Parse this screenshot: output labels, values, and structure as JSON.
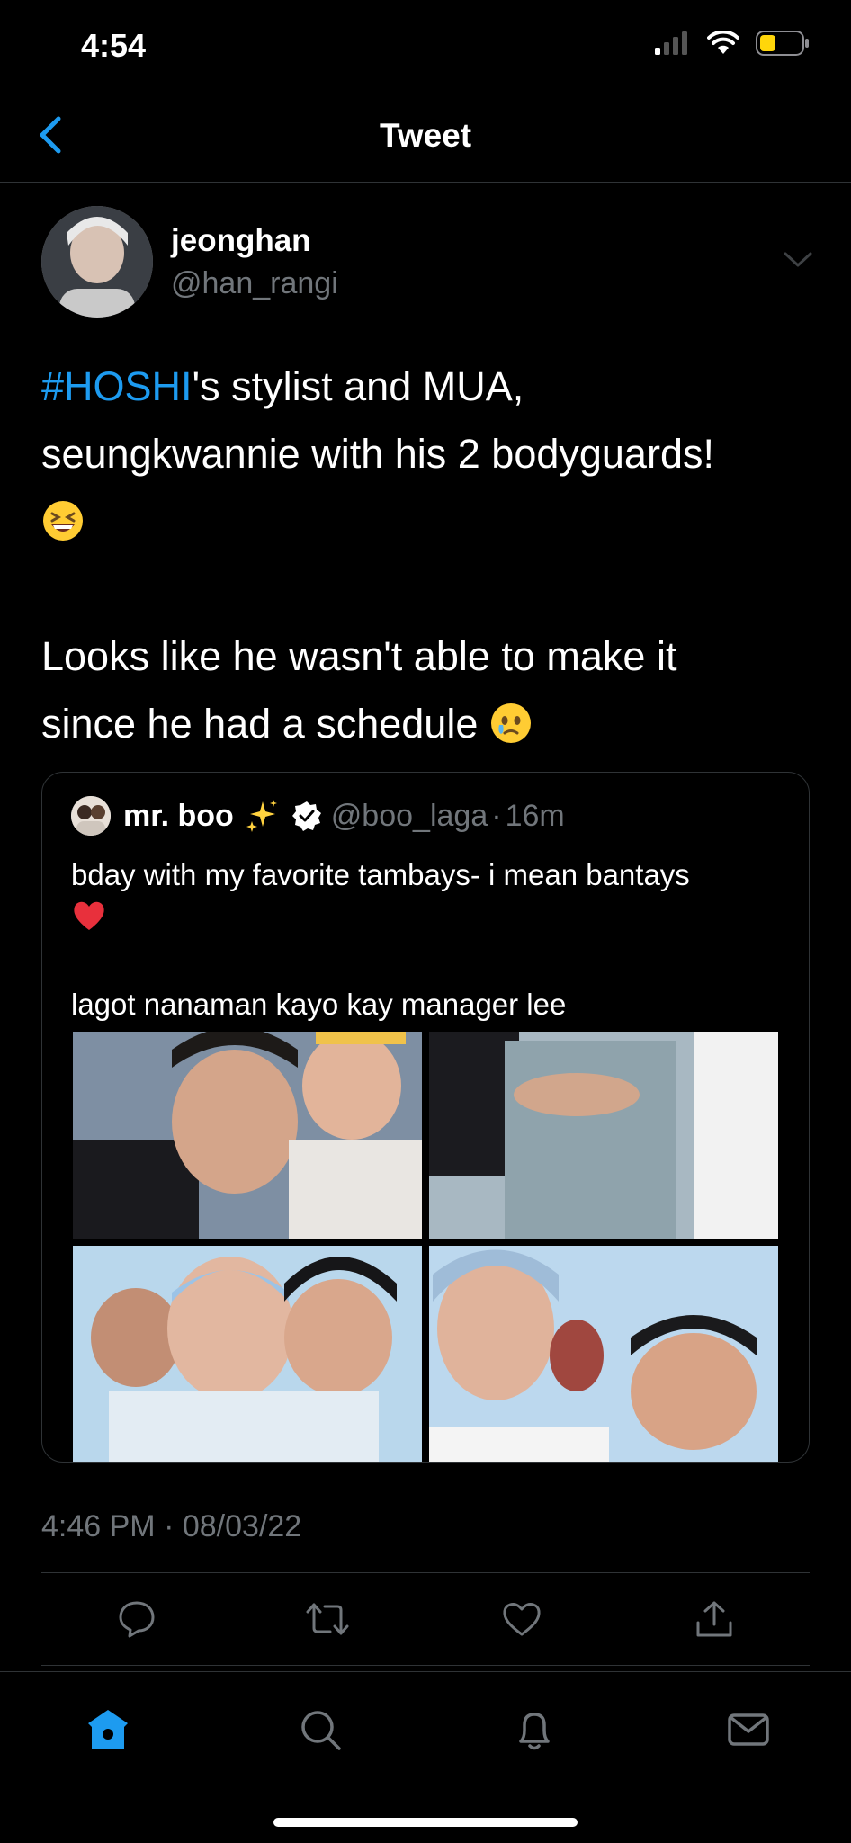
{
  "status_bar": {
    "time": "4:54",
    "battery_color": "#ffd60a"
  },
  "nav": {
    "title": "Tweet",
    "back_icon": "chevron-left-icon"
  },
  "author": {
    "name": "jeonghan",
    "handle": "@han_rangi"
  },
  "tweet": {
    "hashtag": "#HOSHI",
    "line1_rest": "'s stylist and MUA,",
    "line2": "seungkwannie with his 2 bodyguards!",
    "line3_emoji": "grinning-squinting-face",
    "line4": "Looks like he wasn't able to make it",
    "line5": "since he had a schedule",
    "line5_emoji": "face-holding-back-tears"
  },
  "quoted_tweet": {
    "name": "mr. boo",
    "name_emoji": "sparkles",
    "verified": true,
    "handle": "@boo_laga",
    "separator": "·",
    "age": "16m",
    "line1": "bday with my favorite tambays- i mean bantays",
    "line2_emoji": "red-heart",
    "line3": "lagot nanaman kayo kay manager lee",
    "photos_count": 4
  },
  "meta": {
    "time": "4:46 PM",
    "separator": "·",
    "date": "08/03/22"
  },
  "actions": [
    "reply-icon",
    "retweet-icon",
    "like-icon",
    "share-icon"
  ],
  "tabs": [
    "home-icon",
    "search-icon",
    "notifications-icon",
    "messages-icon"
  ],
  "colors": {
    "accent": "#1d9bf0",
    "secondary_text": "#71767b",
    "background": "#000000"
  }
}
